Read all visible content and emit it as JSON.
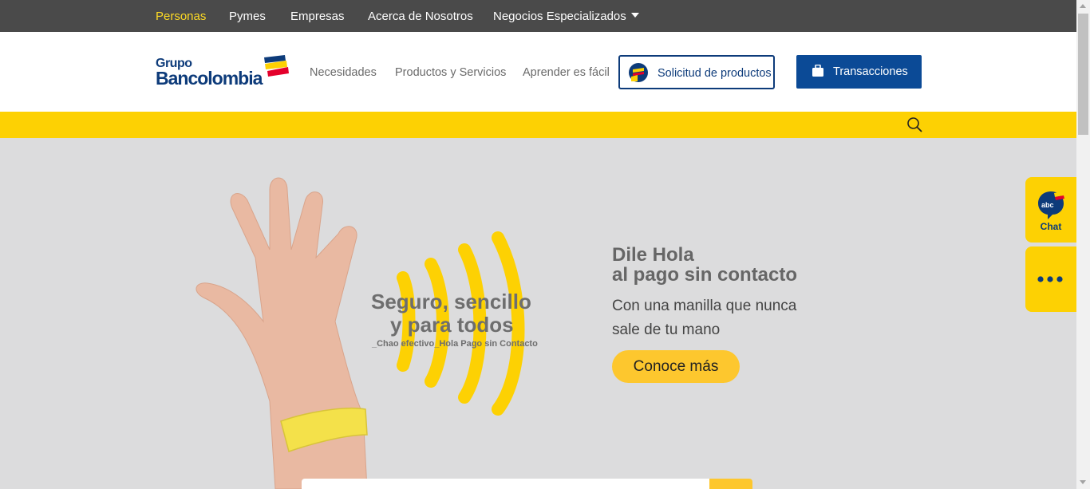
{
  "topnav": {
    "items": [
      {
        "label": "Personas",
        "active": true
      },
      {
        "label": "Pymes"
      },
      {
        "label": "Empresas"
      },
      {
        "label": "Acerca de Nosotros"
      },
      {
        "label": "Negocios Especializados"
      }
    ]
  },
  "header": {
    "logo_line1": "Grupo",
    "logo_line2": "Bancolombia",
    "nav": [
      "Necesidades",
      "Productos y Servicios",
      "Aprender es fácil"
    ],
    "request_button": "Solicitud de productos",
    "transactions_button": "Transacciones"
  },
  "hero": {
    "promo_line1": "Seguro, sencillo",
    "promo_line2": "y para todos",
    "promo_tagline": "_Chao efectivo_Hola Pago sin Contacto",
    "title_line1": "Dile Hola",
    "title_line2": "al pago sin contacto",
    "subtitle_line1": "Con una manilla que nunca",
    "subtitle_line2": "sale de tu mano",
    "cta": "Conoce más"
  },
  "side": {
    "chat_icon_text": "abc",
    "chat_label": "Chat"
  },
  "colors": {
    "topbar": "#4a4a4a",
    "accent_yellow": "#fdd103",
    "brand_blue": "#0d3b7a",
    "button_blue": "#0b4a96"
  },
  "icons": [
    "caret-down-icon",
    "bancolombia-logo-mark",
    "bancolombia-coin-icon",
    "briefcase-icon",
    "search-icon",
    "chat-bubble-icon",
    "more-dots-icon"
  ]
}
